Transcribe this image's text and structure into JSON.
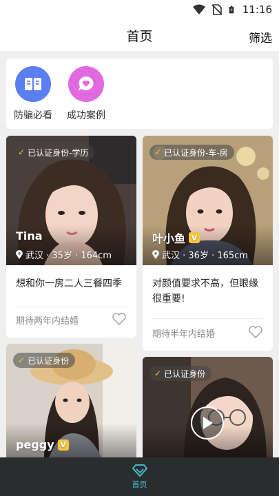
{
  "status_bar": {
    "time": "11:16",
    "icons": [
      "wifi-icon",
      "no-sim-icon",
      "battery-icon"
    ]
  },
  "header": {
    "title": "首页",
    "filter_label": "筛选"
  },
  "quick_links": [
    {
      "label": "防骗必看",
      "icon": "book-icon",
      "color": "#5b7ff0"
    },
    {
      "label": "成功案例",
      "icon": "heart-chat-icon",
      "color": "#e06be0"
    }
  ],
  "profiles": [
    {
      "verified": "已认证身份-学历",
      "name": "Tina",
      "vip": false,
      "info": "武汉 · 35岁 · 164cm",
      "motto": "想和你一房二人三餐四季",
      "expect": "期待两年内结婚"
    },
    {
      "verified": "已认证身份-车-房",
      "name": "叶小鱼",
      "vip": true,
      "info": "武汉 · 36岁 · 165cm",
      "motto": "对颜值要求不高，但眼缘很重要!",
      "expect": "期待半年内结婚"
    },
    {
      "verified": "已认证身份",
      "name": "peggy",
      "vip": true
    },
    {
      "verified": "已认证身份",
      "name": "",
      "video": true
    }
  ],
  "tabbar": {
    "home_label": "首页",
    "icon": "diamond-icon",
    "active_color": "#46c7d4"
  }
}
